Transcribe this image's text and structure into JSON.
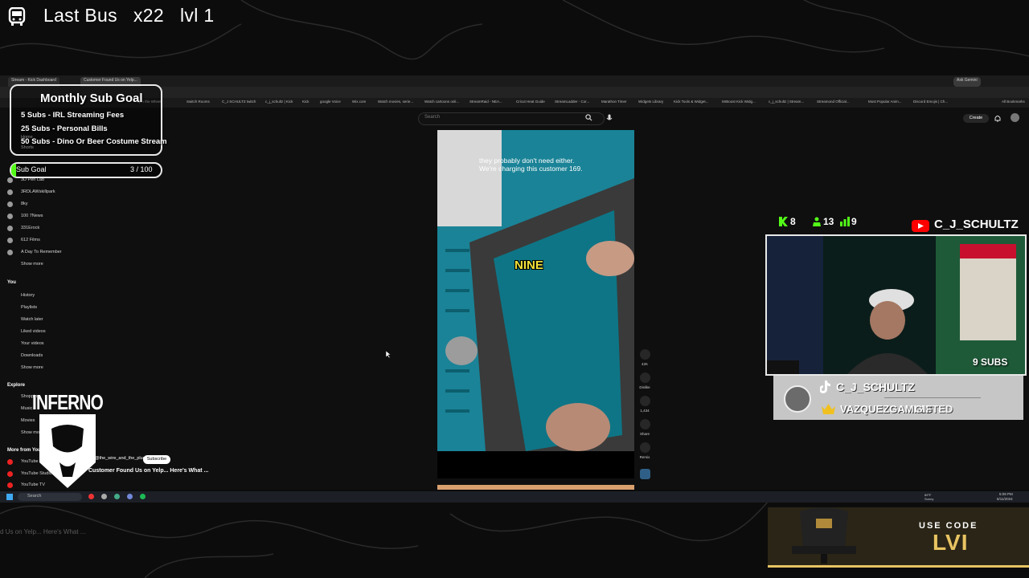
{
  "stream": {
    "title": "Last Bus   x22   lvl 1"
  },
  "browser": {
    "tabs": [
      "Stream - Kick Dashboard",
      "Customer Found Us on Yelp..."
    ],
    "bookmarks": [
      "Spin the Wheel",
      "Switch Rooms",
      "C_J SCHULTZ twitch",
      "c_j_schultz | Kick",
      "Kick",
      "google Voice",
      "Wix.com",
      "Watch movies, serie...",
      "Watch cartoons onli...",
      "StreamRaid - NEA...",
      "Cricut Heat Guide",
      "StreamLadder - Cor...",
      "Marathon Timer",
      "Widgets Library",
      "Kick Tools & Widget...",
      "MrBoost Kick Widg...",
      "c_j_schultz | Stream...",
      "Streamond Official...",
      "Most Popular Anim...",
      "Discord Emojis | Ch...",
      "All Bookmarks"
    ],
    "ask_button": "Ask Gemini"
  },
  "youtube": {
    "search_placeholder": "Search",
    "create_label": "Create",
    "sidebar": {
      "top": [
        "Home",
        "Shorts"
      ],
      "subscriptions": [
        "3D Pen Lab",
        "3RDLAWskillpark",
        "8ky",
        "100 7News",
        "331Erock",
        "612 Films",
        "A Day To Remember",
        "Show more"
      ],
      "you_header": "You",
      "you_items": [
        "History",
        "Playlists",
        "Watch later",
        "Liked videos",
        "Your videos",
        "Downloads",
        "Show more"
      ],
      "explore_header": "Explore",
      "explore_items": [
        "Shopping",
        "Music",
        "Movies",
        "Show more"
      ],
      "more_header": "More from YouTube",
      "more_items": [
        "YouTube Premium",
        "YouTube Studio",
        "YouTube TV"
      ]
    },
    "video": {
      "caption": "they probably don't need either. We're charging this customer 169.",
      "overlay_word": "NINE",
      "channel_handle": "@the_wire_and_the_plug",
      "subscribe_label": "Subscribe",
      "title": "Customer Found Us on Yelp... Here's What ...",
      "actions": [
        {
          "icon": "like-icon",
          "label": "42K"
        },
        {
          "icon": "dislike-icon",
          "label": "Dislike"
        },
        {
          "icon": "comment-icon",
          "label": "1,434"
        },
        {
          "icon": "share-icon",
          "label": "Share"
        },
        {
          "icon": "remix-icon",
          "label": "Remix"
        }
      ]
    }
  },
  "taskbar": {
    "search_placeholder": "Search",
    "weather": "89°F Sunny",
    "time": "5:09 PM",
    "date": "6/11/2024"
  },
  "overlay": {
    "goal": {
      "title": "Monthly Sub Goal",
      "items": [
        "5 Subs - IRL Streaming Fees",
        "25 Subs - Personal Bills",
        "50 Subs - Dino Or Beer Costume Stream"
      ],
      "bar_label": "Sub Goal",
      "bar_count": "3 / 100",
      "progress": 0.03
    },
    "team_logo": "INFERNO",
    "stats": [
      {
        "icon": "kick-icon",
        "value": "8"
      },
      {
        "icon": "follower-icon",
        "value": "13"
      },
      {
        "icon": "viewers-icon",
        "value": "9"
      }
    ],
    "channel_name": "C_J_SCHULTZ",
    "webcam_badge": "9 SUBS",
    "card": {
      "name": "C_J_SCHULTZ",
      "gifter": "VAZQUEZGAMING",
      "gift_suffix": "GIFTED"
    },
    "promo": {
      "line1": "USE CODE",
      "line2": "LVI"
    },
    "colors": {
      "kick_green": "#53fc18",
      "youtube_red": "#ff0000",
      "promo_gold": "#e8c462"
    }
  }
}
